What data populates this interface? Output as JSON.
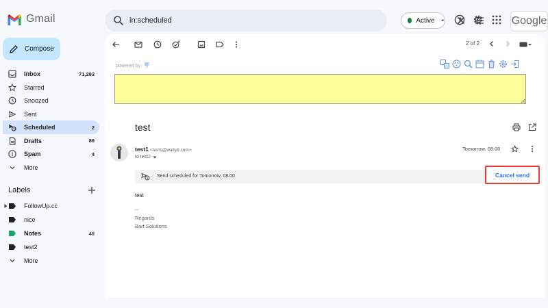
{
  "app": {
    "name": "Gmail"
  },
  "search": {
    "value": "in:scheduled"
  },
  "status": {
    "label": "Active",
    "color": "#188038"
  },
  "google_brand": "Google",
  "compose_label": "Compose",
  "nav": [
    {
      "label": "Inbox",
      "count": "71,293",
      "icon": "inbox-icon",
      "bold": true
    },
    {
      "label": "Starred",
      "count": "",
      "icon": "star-icon"
    },
    {
      "label": "Snoozed",
      "count": "",
      "icon": "clock-icon"
    },
    {
      "label": "Sent",
      "count": "",
      "icon": "send-icon"
    },
    {
      "label": "Scheduled",
      "count": "2",
      "icon": "schedule-send-icon",
      "active": true
    },
    {
      "label": "Drafts",
      "count": "86",
      "icon": "draft-icon",
      "bold": true
    },
    {
      "label": "Spam",
      "count": "4",
      "icon": "spam-icon",
      "bold": true
    },
    {
      "label": "More",
      "count": "",
      "icon": "chevron-down-icon"
    }
  ],
  "labels": {
    "heading": "Labels",
    "items": [
      {
        "label": "FollowUp.cc",
        "color": "#202124"
      },
      {
        "label": "nice",
        "color": "#202124"
      },
      {
        "label": "Notes",
        "count": "48",
        "color": "#16a765",
        "bold": true
      },
      {
        "label": "test2",
        "color": "#202124"
      },
      {
        "label": "More"
      }
    ]
  },
  "toolbar": {
    "pager": "2 of 2"
  },
  "extension": {
    "powered_by": "powered by"
  },
  "message": {
    "subject": "test",
    "sender_name": "test1",
    "sender_email": "<test1@walty8.com>",
    "to": "to test2",
    "time": "Tomorrow, 08:00",
    "scheduled_text": "Send scheduled for Tomorrow, 08:00",
    "cancel_label": "Cancel send",
    "body": "test",
    "signature_separator": "--",
    "signature_line1": "Regards",
    "signature_line2": "Bart Solutions"
  },
  "colors": {
    "accent": "#1a73e8",
    "highlight_border": "#e53935",
    "compose_bg": "#c2e7ff",
    "active_nav": "#d3e3fd",
    "note_bg": "#ffff99"
  }
}
